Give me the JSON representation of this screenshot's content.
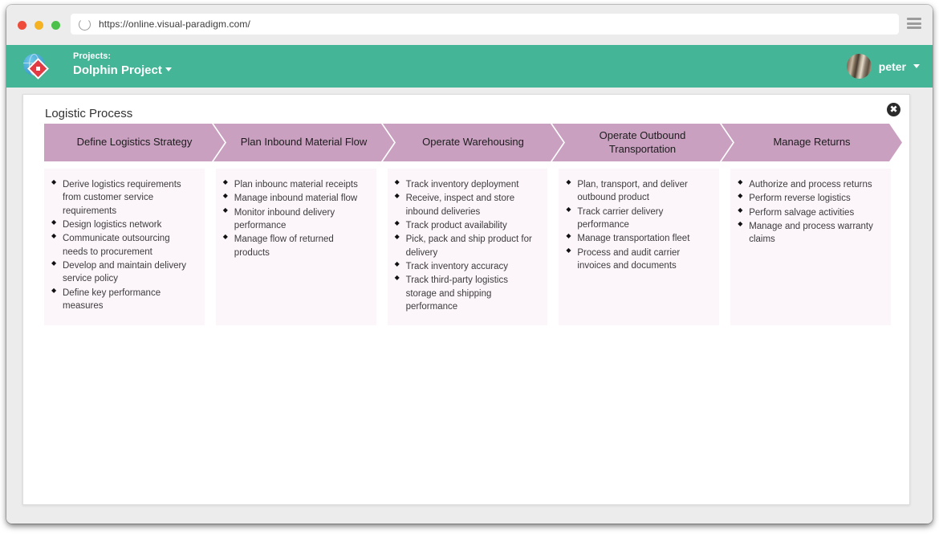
{
  "browser": {
    "url": "https://online.visual-paradigm.com/",
    "reload_icon": "reload-icon",
    "menu_icon": "hamburger-menu-icon",
    "traffic_lights": [
      "close",
      "minimize",
      "maximize"
    ]
  },
  "header": {
    "logo_icon": "visual-paradigm-logo-icon",
    "projects_label": "Projects:",
    "project_name": "Dolphin Project",
    "project_caret_icon": "caret-down-icon",
    "user_name": "peter",
    "user_caret_icon": "caret-down-icon",
    "avatar_icon": "user-avatar",
    "background_color": "#45b598"
  },
  "dialog": {
    "title": "Logistic Process",
    "close_icon": "close-icon"
  },
  "process": {
    "chevron_color": "#c9a0c0",
    "panel_color": "#fcf5fa",
    "stages": [
      {
        "title": "Define Logistics Strategy",
        "items": [
          "Derive logistics requirements from customer service requirements",
          "Design logistics network",
          "Communicate outsourcing needs to procurement",
          "Develop and maintain delivery service policy",
          "Define key performance measures"
        ]
      },
      {
        "title": "Plan Inbound Material Flow",
        "items": [
          "Plan inbounc material receipts",
          "Manage inbound material flow",
          "Monitor inbound delivery performance",
          "Manage flow of returned products"
        ]
      },
      {
        "title": "Operate Warehousing",
        "items": [
          "Track inventory deployment",
          "Receive, inspect and store inbound deliveries",
          "Track product availability",
          "Pick, pack and ship product for delivery",
          "Track inventory accuracy",
          "Track third-party logistics storage and shipping performance"
        ]
      },
      {
        "title": "Operate Outbound Transportation",
        "items": [
          "Plan, transport, and deliver outbound product",
          "Track carrier delivery performance",
          "Manage transportation fleet",
          "Process and audit carrier invoices and documents"
        ]
      },
      {
        "title": "Manage Returns",
        "items": [
          "Authorize and process returns",
          "Perform reverse logistics",
          "Perform salvage activities",
          "Manage and process warranty claims"
        ]
      }
    ]
  }
}
